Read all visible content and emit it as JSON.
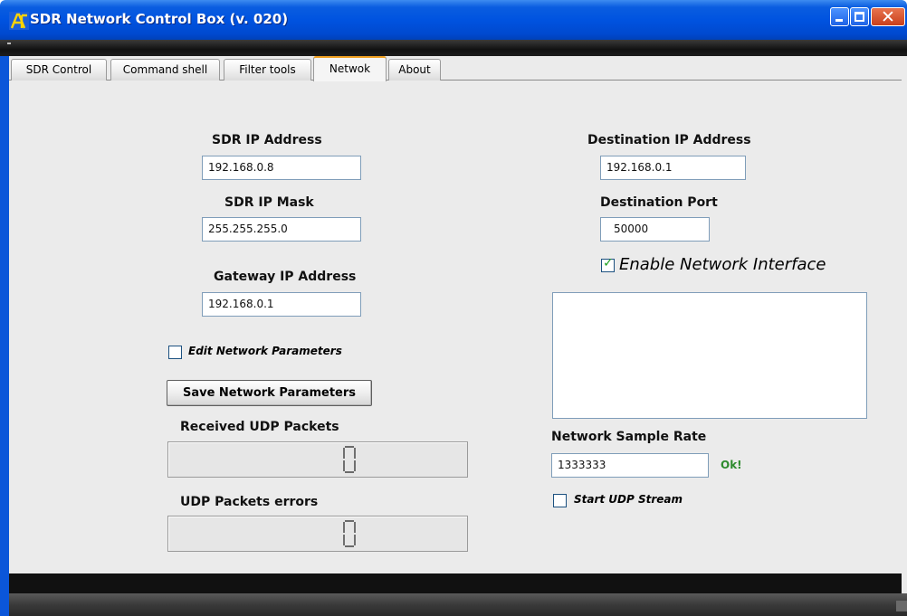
{
  "window": {
    "title": "SDR Network Control Box (v. 020)",
    "app_icon": "antenna-icon",
    "controls": {
      "minimize": "minimize-icon",
      "maximize": "maximize-icon",
      "close": "close-icon",
      "close_glyph": "✕"
    }
  },
  "tabs": [
    {
      "label": "SDR Control",
      "active": false
    },
    {
      "label": "Command shell",
      "active": false
    },
    {
      "label": "Filter tools",
      "active": false
    },
    {
      "label": "Netwok",
      "active": true
    },
    {
      "label": "About",
      "active": false
    }
  ],
  "left": {
    "sdr_ip_label": "SDR IP Address",
    "sdr_ip_value": "192.168.0.8",
    "sdr_mask_label": "SDR IP Mask",
    "sdr_mask_value": "255.255.255.0",
    "gateway_label": "Gateway IP Address",
    "gateway_value": "192.168.0.1",
    "edit_params_label": "Edit Network Parameters",
    "edit_params_checked": false,
    "save_button": "Save Network Parameters",
    "received_label": "Received UDP Packets",
    "received_value": "0",
    "errors_label": "UDP Packets errors",
    "errors_value": "0"
  },
  "right": {
    "dest_ip_label": "Destination IP Address",
    "dest_ip_value": "192.168.0.1",
    "dest_port_label": "Destination Port",
    "dest_port_value": "50000",
    "enable_label": "Enable Network Interface",
    "enable_checked": true,
    "check_glyph": "✓",
    "sample_rate_label": "Network Sample Rate",
    "sample_rate_value": "1333333",
    "sample_rate_status": "Ok!",
    "start_udp_label": "Start UDP Stream",
    "start_udp_checked": false
  },
  "colors": {
    "titlebar": "#0053e0",
    "status_ok": "#2e8b2e",
    "active_tab_accent": "#f0a020"
  }
}
